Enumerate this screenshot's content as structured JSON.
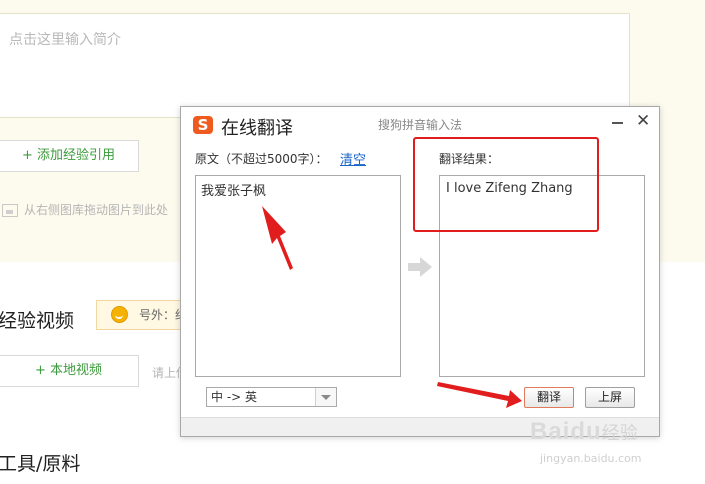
{
  "editor": {
    "intro_placeholder": "点击这里输入简介",
    "add_reference_label": "+ 添加经验引用",
    "drag_hint": "从右侧图库拖动图片到此处",
    "video_section_title": "经验视频",
    "tip_badge": "号外：约",
    "local_video_label": "+ 本地视频",
    "upload_hint": "请上传",
    "tools_section_title": "工具/原料"
  },
  "dialog": {
    "title": "在线翻译",
    "subtitle": "搜狗拼音输入法",
    "logo_letter": "S",
    "close_glyph": "✕",
    "source_label": "原文（不超过5000字）：",
    "clear_link": "清空",
    "result_label": "翻译结果：",
    "source_text": "我爱张子枫",
    "result_text": "I love Zifeng Zhang",
    "direction": "中 -> 英",
    "translate_button": "翻译",
    "send_button": "上屏"
  },
  "icons": {
    "arrow": "right-arrow-icon",
    "logo": "sogou-logo-icon",
    "minimize": "minimize-icon",
    "close": "close-icon",
    "dropdown": "chevron-down-icon",
    "tip": "lightbulb-icon",
    "image": "image-icon"
  },
  "annotations": {
    "color": "#e21d1d"
  },
  "watermark": {
    "brand": "Baidu",
    "cn": "经验",
    "url": "jingyan.baidu.com"
  },
  "colors": {
    "accent_green": "#3c9b3c",
    "link_blue": "#1a64c8",
    "logo_orange": "#ef5a1f",
    "page_bg": "#fdfbee"
  }
}
